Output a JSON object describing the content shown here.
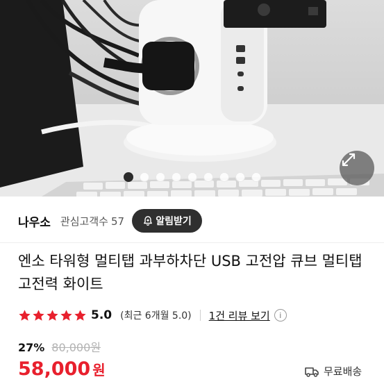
{
  "gallery": {
    "total_images": 9,
    "current_index": 0
  },
  "seller": {
    "name": "나우소",
    "interest_label": "관심고객수",
    "interest_count": "57",
    "follow_label": "알림받기"
  },
  "product": {
    "title": "엔소 타워형 멀티탭 과부하차단 USB 고전압 큐브 멀티탭 고전력 화이트"
  },
  "rating": {
    "stars": 5,
    "score": "5.0",
    "recent": "(최근 6개월 5.0)",
    "review_link": "1건 리뷰 보기",
    "info": "i"
  },
  "price": {
    "discount": "27%",
    "original": "80,000원",
    "current": "58,000",
    "currency": "원"
  },
  "shipping": {
    "label": "무료배송"
  },
  "colors": {
    "price_red": "#e8202d",
    "star_red": "#e8202d",
    "button_dark": "#2f2f2f"
  }
}
